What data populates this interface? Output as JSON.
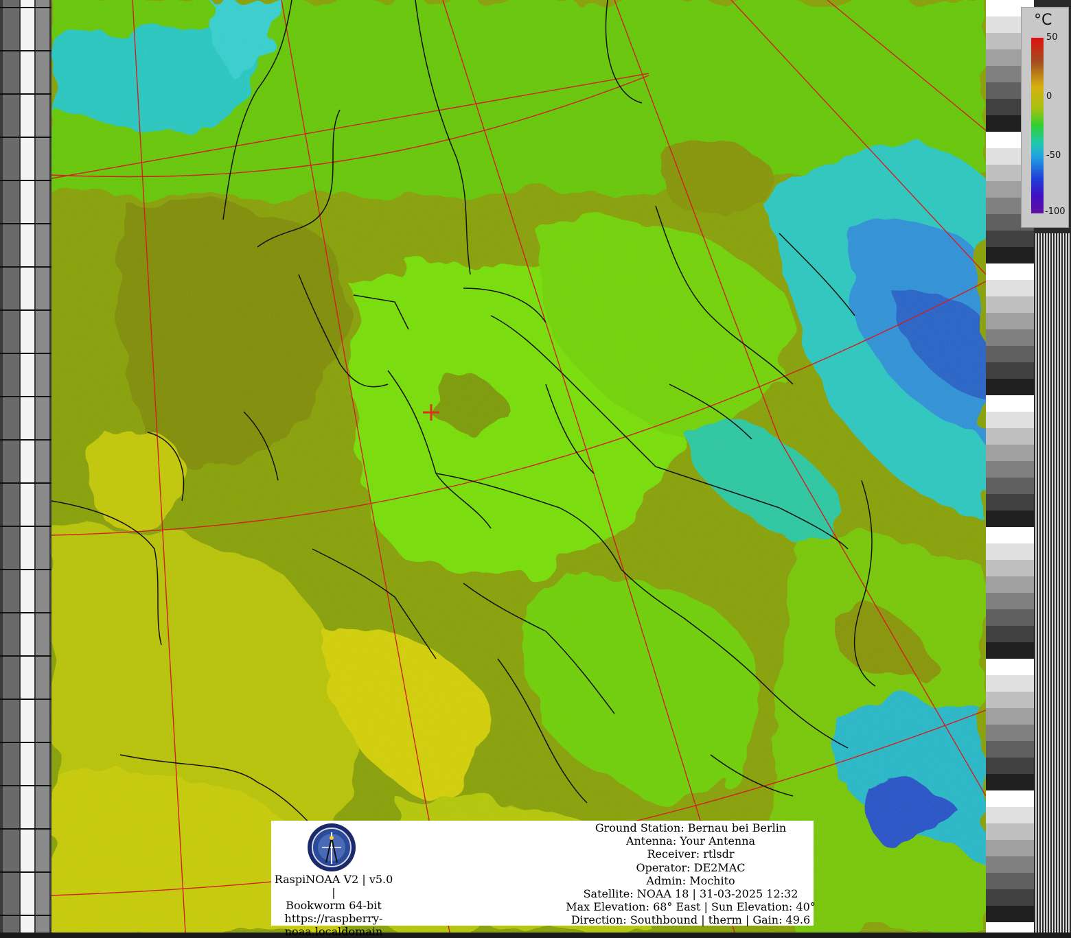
{
  "scale": {
    "unit": "°C",
    "ticks": [
      "50",
      "0",
      "-50",
      "-100"
    ]
  },
  "colors": {
    "warm": "#d8d000",
    "land_olive": "#8c9800",
    "green": "#70e000",
    "cyan": "#20d0d0",
    "blue": "#2050d0",
    "grid_line": "#d02020",
    "border_line": "#111111"
  },
  "map": {
    "marker": "station-cross",
    "legend_icon": "raspinoaa-logo-icon"
  },
  "info": {
    "software": [
      "RaspiNOAA V2 | v5.0 |",
      "Bookworm 64-bit",
      "https://raspberry-",
      "noaa.localdomain"
    ],
    "station": [
      "Ground Station: Bernau bei Berlin",
      "Antenna: Your Antenna",
      "Receiver: rtlsdr",
      "Operator: DE2MAC",
      "Admin: Mochito",
      "Satellite: NOAA 18 | 31-03-2025 12:32",
      "Max Elevation: 68° East | Sun Elevation: 40°",
      "Direction: Southbound | therm | Gain: 49.6"
    ]
  }
}
